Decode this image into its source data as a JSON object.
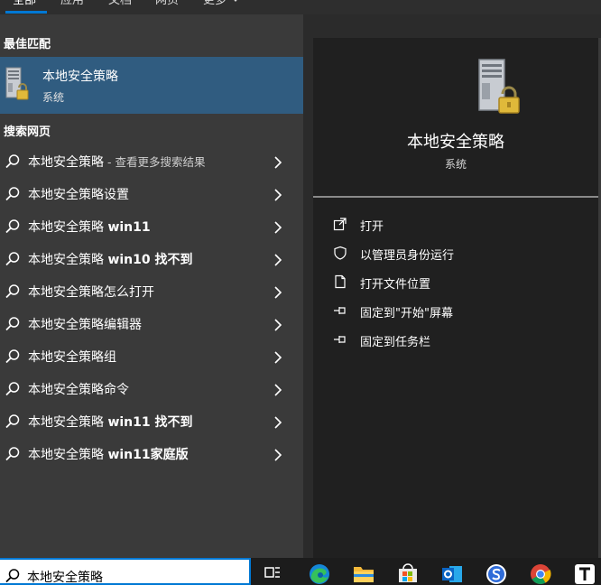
{
  "tabs": [
    {
      "label": "全部",
      "active": true
    },
    {
      "label": "应用"
    },
    {
      "label": "文档"
    },
    {
      "label": "网页"
    },
    {
      "label": "更多"
    }
  ],
  "best_match": {
    "heading": "最佳匹配",
    "title": "本地安全策略",
    "subtitle": "系统",
    "icon": "server-lock-icon"
  },
  "web_search": {
    "heading": "搜索网页",
    "items": [
      {
        "normal": "本地安全策略",
        "bold": "",
        "suffix": " - 查看更多搜索结果"
      },
      {
        "normal": "本地安全策略设置",
        "bold": "",
        "suffix": ""
      },
      {
        "normal": "本地安全策略 ",
        "bold": "win11",
        "suffix": ""
      },
      {
        "normal": "本地安全策略 ",
        "bold": "win10 找不到",
        "suffix": ""
      },
      {
        "normal": "本地安全策略怎么打开",
        "bold": "",
        "suffix": ""
      },
      {
        "normal": "本地安全策略编辑器",
        "bold": "",
        "suffix": ""
      },
      {
        "normal": "本地安全策略组",
        "bold": "",
        "suffix": ""
      },
      {
        "normal": "本地安全策略命令",
        "bold": "",
        "suffix": ""
      },
      {
        "normal": "本地安全策略 ",
        "bold": "win11 找不到",
        "suffix": ""
      },
      {
        "normal": "本地安全策略 ",
        "bold": "win11家庭版",
        "suffix": ""
      }
    ]
  },
  "detail": {
    "title": "本地安全策略",
    "subtitle": "系统",
    "actions": [
      {
        "label": "打开",
        "icon": "open-icon"
      },
      {
        "label": "以管理员身份运行",
        "icon": "shield-icon"
      },
      {
        "label": "打开文件位置",
        "icon": "file-location-icon"
      },
      {
        "label": "固定到\"开始\"屏幕",
        "icon": "pin-icon"
      },
      {
        "label": "固定到任务栏",
        "icon": "pin-icon"
      }
    ]
  },
  "taskbar": {
    "search_query": "本地安全策略",
    "apps": [
      "task-view-icon",
      "edge-icon",
      "file-explorer-icon",
      "store-icon",
      "outlook-icon",
      "sogou-icon",
      "chrome-icon",
      "typora-icon"
    ]
  },
  "colors": {
    "accent": "#0078d4",
    "selected_row": "#305c80",
    "left_pane": "#3a3a3a",
    "right_pane": "#202020"
  }
}
